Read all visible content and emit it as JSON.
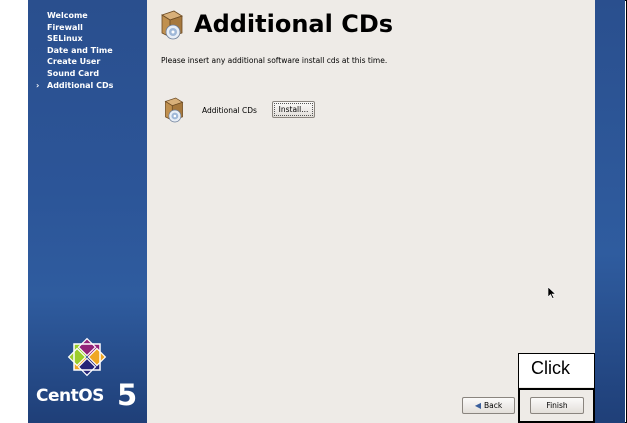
{
  "sidebar": {
    "steps": [
      {
        "label": "Welcome"
      },
      {
        "label": "Firewall"
      },
      {
        "label": "SELinux"
      },
      {
        "label": "Date and Time"
      },
      {
        "label": "Create User"
      },
      {
        "label": "Sound Card"
      },
      {
        "label": "Additional CDs",
        "current": true
      }
    ],
    "current_marker": "›",
    "logo_text": "CentOS",
    "logo_number": "5"
  },
  "main": {
    "title": "Additional CDs",
    "instruction": "Please insert any additional software install cds at this time.",
    "cd_label": "Additional CDs",
    "install_button": "Install..."
  },
  "footer": {
    "back_button": "Back",
    "finish_button": "Finish"
  },
  "annotation": {
    "label": "Click"
  },
  "colors": {
    "sidebar_blue": "#2c5598",
    "content_bg": "#eeebe7"
  }
}
